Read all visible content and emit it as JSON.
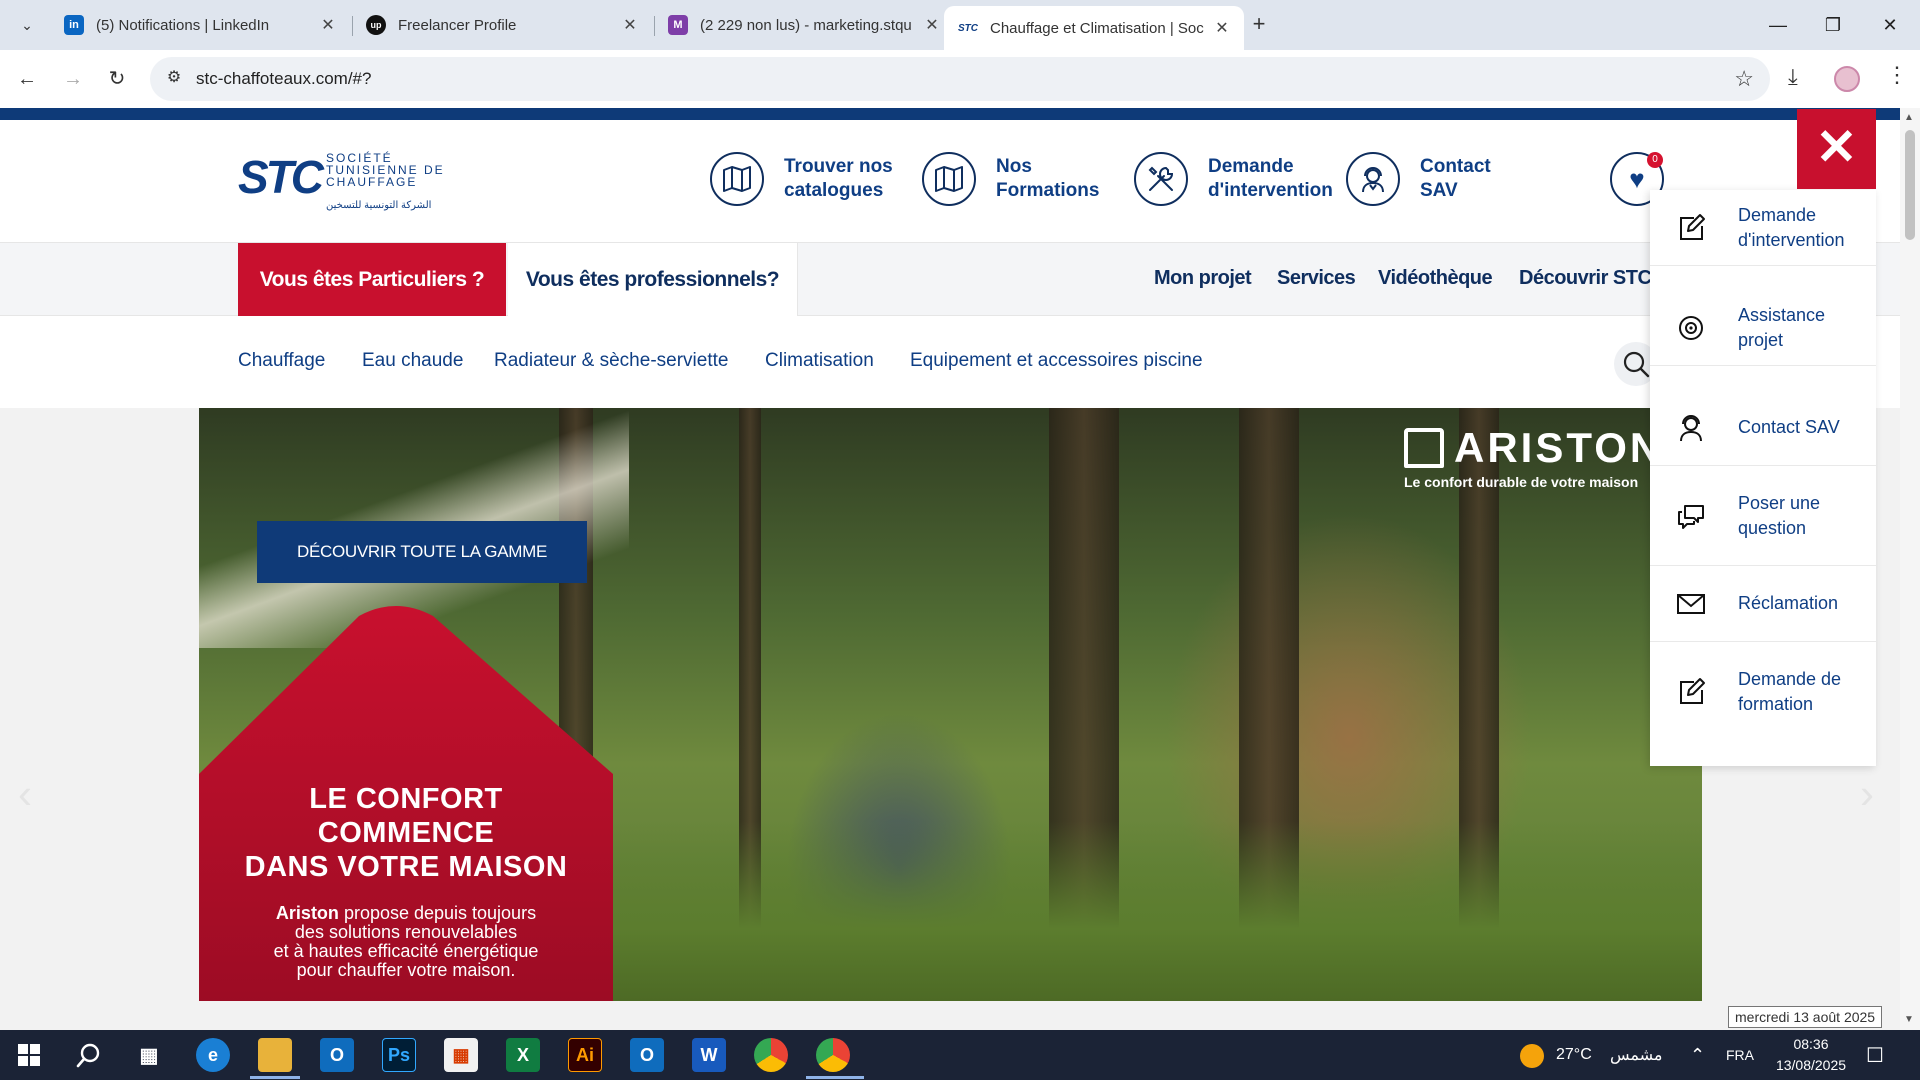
{
  "browser": {
    "tabs": [
      {
        "title": "(5) Notifications | LinkedIn",
        "favicon": "in",
        "color": "#0a66c2"
      },
      {
        "title": "Freelancer Profile",
        "favicon": "up",
        "color": "#111111"
      },
      {
        "title": "(2 229 non lus) - marketing.stqu",
        "favicon": "M",
        "color": "#7e3ea8"
      },
      {
        "title": "Chauffage et Climatisation | Soc",
        "favicon": "STC",
        "color": "#0f3e84"
      }
    ],
    "url": "stc-chaffoteaux.com/#?"
  },
  "header": {
    "logo_text": "STC",
    "logo_tagline": "SOCIÉTÉ TUNISIENNE DE CHAUFFAGE",
    "logo_arabic": "الشركة التونسية للتسخين",
    "links": [
      {
        "label": "Trouver nos catalogues",
        "icon": "map-icon"
      },
      {
        "label": "Nos Formations",
        "icon": "map-icon"
      },
      {
        "label": "Demande d'intervention",
        "icon": "tools-icon"
      },
      {
        "label": "Contact SAV",
        "icon": "support-agent-icon"
      }
    ],
    "favorites_count": "0"
  },
  "nav": {
    "particuliers": "Vous êtes Particuliers ?",
    "professionnels": "Vous êtes professionnels?",
    "items": [
      "Mon projet",
      "Services",
      "Vidéothèque",
      "Découvrir STC"
    ]
  },
  "categories": [
    "Chauffage",
    "Eau chaude",
    "Radiateur & sèche-serviette",
    "Climatisation",
    "Equipement et accessoires piscine"
  ],
  "hero": {
    "cta": "DÉCOUVRIR TOUTE LA GAMME",
    "title_lines": [
      "LE CONFORT",
      "COMMENCE",
      "DANS VOTRE MAISON"
    ],
    "brand_word": "Ariston",
    "text_line1": "propose depuis toujours",
    "text_line2": "des solutions renouvelables",
    "text_line3": "et à hautes efficacité énergétique",
    "text_line4": "pour chauffer votre maison.",
    "brand_logo": "ARISTON",
    "brand_slogan": "Le confort durable de votre maison"
  },
  "side_menu": [
    {
      "label": "Demande d'intervention",
      "icon": "edit-icon"
    },
    {
      "label": "Assistance projet",
      "icon": "assistance-icon"
    },
    {
      "label": "Contact SAV",
      "icon": "support-agent-icon"
    },
    {
      "label": "Poser une question",
      "icon": "chat-icon"
    },
    {
      "label": "Réclamation",
      "icon": "mail-icon"
    },
    {
      "label": "Demande de formation",
      "icon": "edit-icon"
    }
  ],
  "tooltip_date": "mercredi 13 août 2025",
  "taskbar": {
    "temperature": "27°C",
    "weather_text": "مشمس",
    "lang": "FRA",
    "time": "08:36",
    "date": "13/08/2025"
  },
  "colors": {
    "brand_blue": "#0f3e84",
    "brand_red": "#c8102e",
    "navy": "#0f2e5e"
  }
}
